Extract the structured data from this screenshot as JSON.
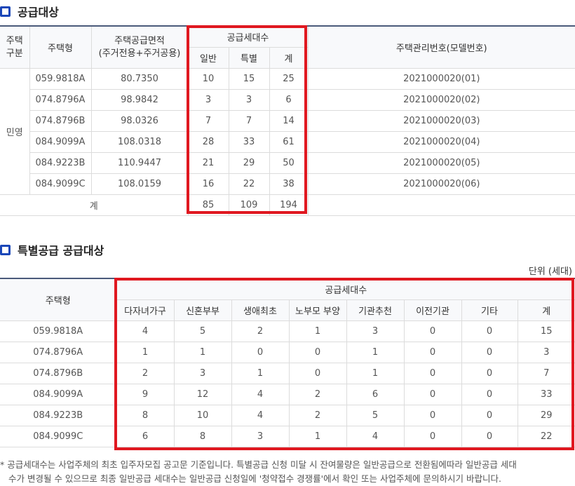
{
  "section1": {
    "title": "공급대상",
    "headers": {
      "type_line1": "주택",
      "type_line2": "구분",
      "housing_type": "주택형",
      "area_line1": "주택공급면적",
      "area_line2": "(주거전용+주거공용)",
      "supply_units": "공급세대수",
      "general": "일반",
      "special": "특별",
      "total": "계",
      "mgmt_no": "주택관리번호(모델번호)"
    },
    "category": "민영",
    "rows": [
      {
        "type": "059.9818A",
        "area": "80.7350",
        "general": "10",
        "special": "15",
        "total": "25",
        "mgmt": "2021000020(01)"
      },
      {
        "type": "074.8796A",
        "area": "98.9842",
        "general": "3",
        "special": "3",
        "total": "6",
        "mgmt": "2021000020(02)"
      },
      {
        "type": "074.8796B",
        "area": "98.0326",
        "general": "7",
        "special": "7",
        "total": "14",
        "mgmt": "2021000020(03)"
      },
      {
        "type": "084.9099A",
        "area": "108.0318",
        "general": "28",
        "special": "33",
        "total": "61",
        "mgmt": "2021000020(04)"
      },
      {
        "type": "084.9223B",
        "area": "110.9447",
        "general": "21",
        "special": "29",
        "total": "50",
        "mgmt": "2021000020(05)"
      },
      {
        "type": "084.9099C",
        "area": "108.0159",
        "general": "16",
        "special": "22",
        "total": "38",
        "mgmt": "2021000020(06)"
      }
    ],
    "sum": {
      "label": "계",
      "general": "85",
      "special": "109",
      "total": "194"
    }
  },
  "section2": {
    "title": "특별공급 공급대상",
    "unit": "단위 (세대)",
    "headers": {
      "housing_type": "주택형",
      "supply_units": "공급세대수",
      "cols": [
        "다자녀가구",
        "신혼부부",
        "생애최초",
        "노부모 부양",
        "기관추천",
        "이전기관",
        "기타",
        "계"
      ]
    },
    "rows": [
      {
        "type": "059.9818A",
        "vals": [
          "4",
          "5",
          "2",
          "1",
          "3",
          "0",
          "0",
          "15"
        ]
      },
      {
        "type": "074.8796A",
        "vals": [
          "1",
          "1",
          "0",
          "0",
          "1",
          "0",
          "0",
          "3"
        ]
      },
      {
        "type": "074.8796B",
        "vals": [
          "2",
          "3",
          "1",
          "0",
          "1",
          "0",
          "0",
          "7"
        ]
      },
      {
        "type": "084.9099A",
        "vals": [
          "9",
          "12",
          "4",
          "2",
          "6",
          "0",
          "0",
          "33"
        ]
      },
      {
        "type": "084.9223B",
        "vals": [
          "8",
          "10",
          "4",
          "2",
          "5",
          "0",
          "0",
          "29"
        ]
      },
      {
        "type": "084.9099C",
        "vals": [
          "6",
          "8",
          "3",
          "1",
          "4",
          "0",
          "0",
          "22"
        ]
      }
    ]
  },
  "note": {
    "line1": "* 공급세대수는 사업주체의 최초 입주자모집 공고문 기준입니다. 특별공급 신청 미달 시 잔여물량은 일반공급으로 전환됨에따라 일반공급 세대",
    "line2": "수가 변경될 수 있으므로 최종 일반공급 세대수는 일반공급 신청일에 '청약접수 경쟁률'에서 확인 또는 사업주체에 문의하시기 바랍니다."
  },
  "colors": {
    "accent": "#1a47b8",
    "highlight": "#e01820"
  }
}
